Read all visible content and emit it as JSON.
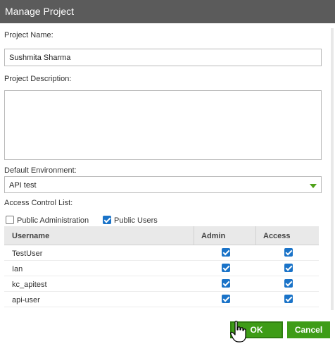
{
  "dialog": {
    "title": "Manage Project"
  },
  "form": {
    "project_name_label": "Project Name:",
    "project_name_value": "Sushmita Sharma",
    "project_description_label": "Project Description:",
    "project_description_value": "",
    "default_environment_label": "Default Environment:",
    "default_environment_value": "API test",
    "access_control_label": "Access Control List:",
    "public_administration_label": "Public Administration",
    "public_administration_checked": false,
    "public_users_label": "Public Users",
    "public_users_checked": true
  },
  "table": {
    "headers": {
      "username": "Username",
      "admin": "Admin",
      "access": "Access"
    },
    "rows": [
      {
        "username": "TestUser",
        "admin": true,
        "access": true
      },
      {
        "username": "Ian",
        "admin": true,
        "access": true
      },
      {
        "username": "kc_apitest",
        "admin": true,
        "access": true
      },
      {
        "username": "api-user",
        "admin": true,
        "access": true
      }
    ]
  },
  "buttons": {
    "ok": "OK",
    "cancel": "Cancel"
  },
  "colors": {
    "titlebar": "#5b5b5b",
    "button_green": "#3e9c17",
    "checkbox_blue": "#1a73c8",
    "select_arrow": "#4fa11a"
  },
  "icons": {
    "cursor": "hand-pointer-icon",
    "select_arrow": "chevron-down-icon",
    "checkbox": "checkmark-icon"
  }
}
